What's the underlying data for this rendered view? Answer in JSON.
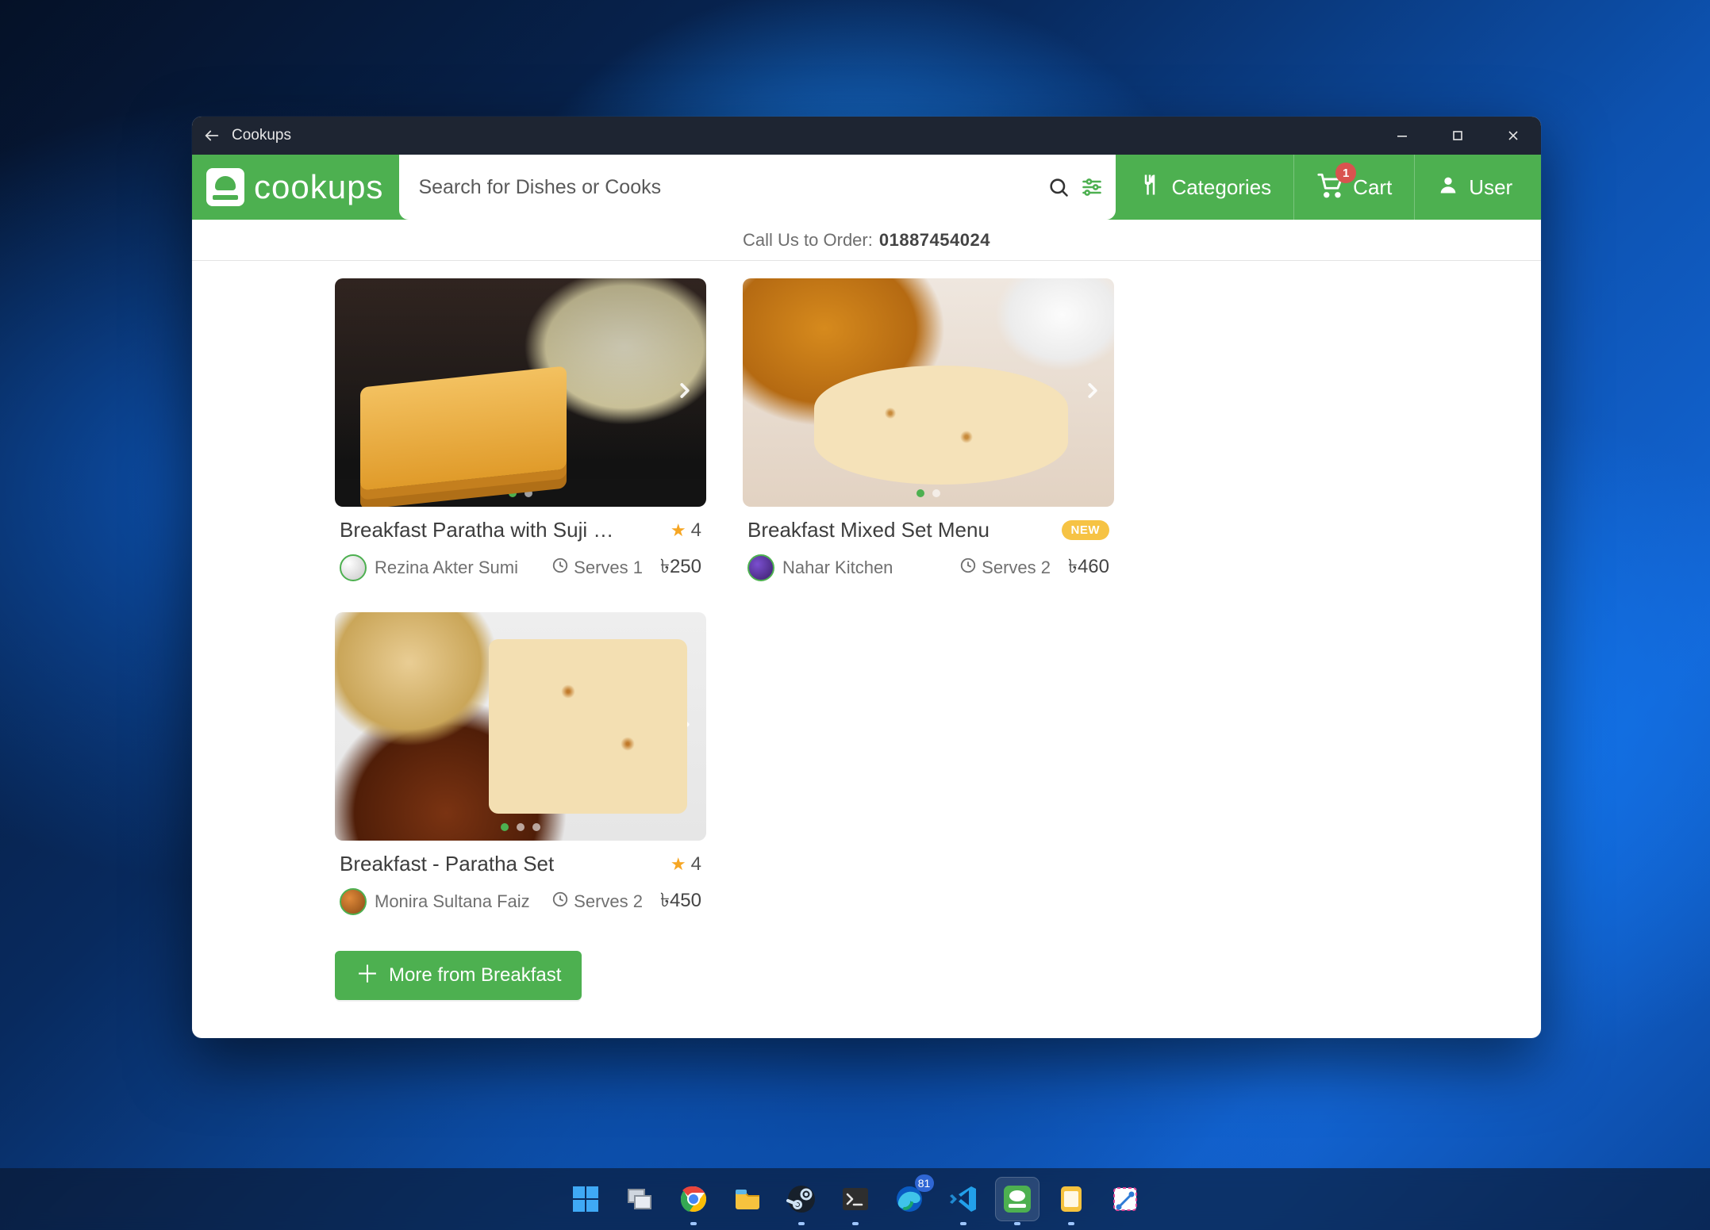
{
  "window": {
    "title": "Cookups"
  },
  "brand": {
    "name": "cookups"
  },
  "search": {
    "placeholder": "Search for Dishes or Cooks"
  },
  "nav": {
    "categories_label": "Categories",
    "cart_label": "Cart",
    "cart_count": "1",
    "user_label": "User"
  },
  "call_strip": {
    "label": "Call Us to Order:",
    "phone": "01887454024"
  },
  "dishes": [
    {
      "title": "Breakfast Paratha with Suji Fo...",
      "rating": "4",
      "cook": "Rezina Akter Sumi",
      "serves": "Serves 1",
      "price": "৳250",
      "badge": null
    },
    {
      "title": "Breakfast Mixed Set Menu",
      "rating": null,
      "cook": "Nahar Kitchen",
      "serves": "Serves 2",
      "price": "৳460",
      "badge": "NEW"
    },
    {
      "title": "Breakfast - Paratha Set",
      "rating": "4",
      "cook": "Monira Sultana Faiz",
      "serves": "Serves 2",
      "price": "৳450",
      "badge": null
    }
  ],
  "more_button": "More from Breakfast",
  "taskbar": {
    "edge_badge": "81"
  }
}
